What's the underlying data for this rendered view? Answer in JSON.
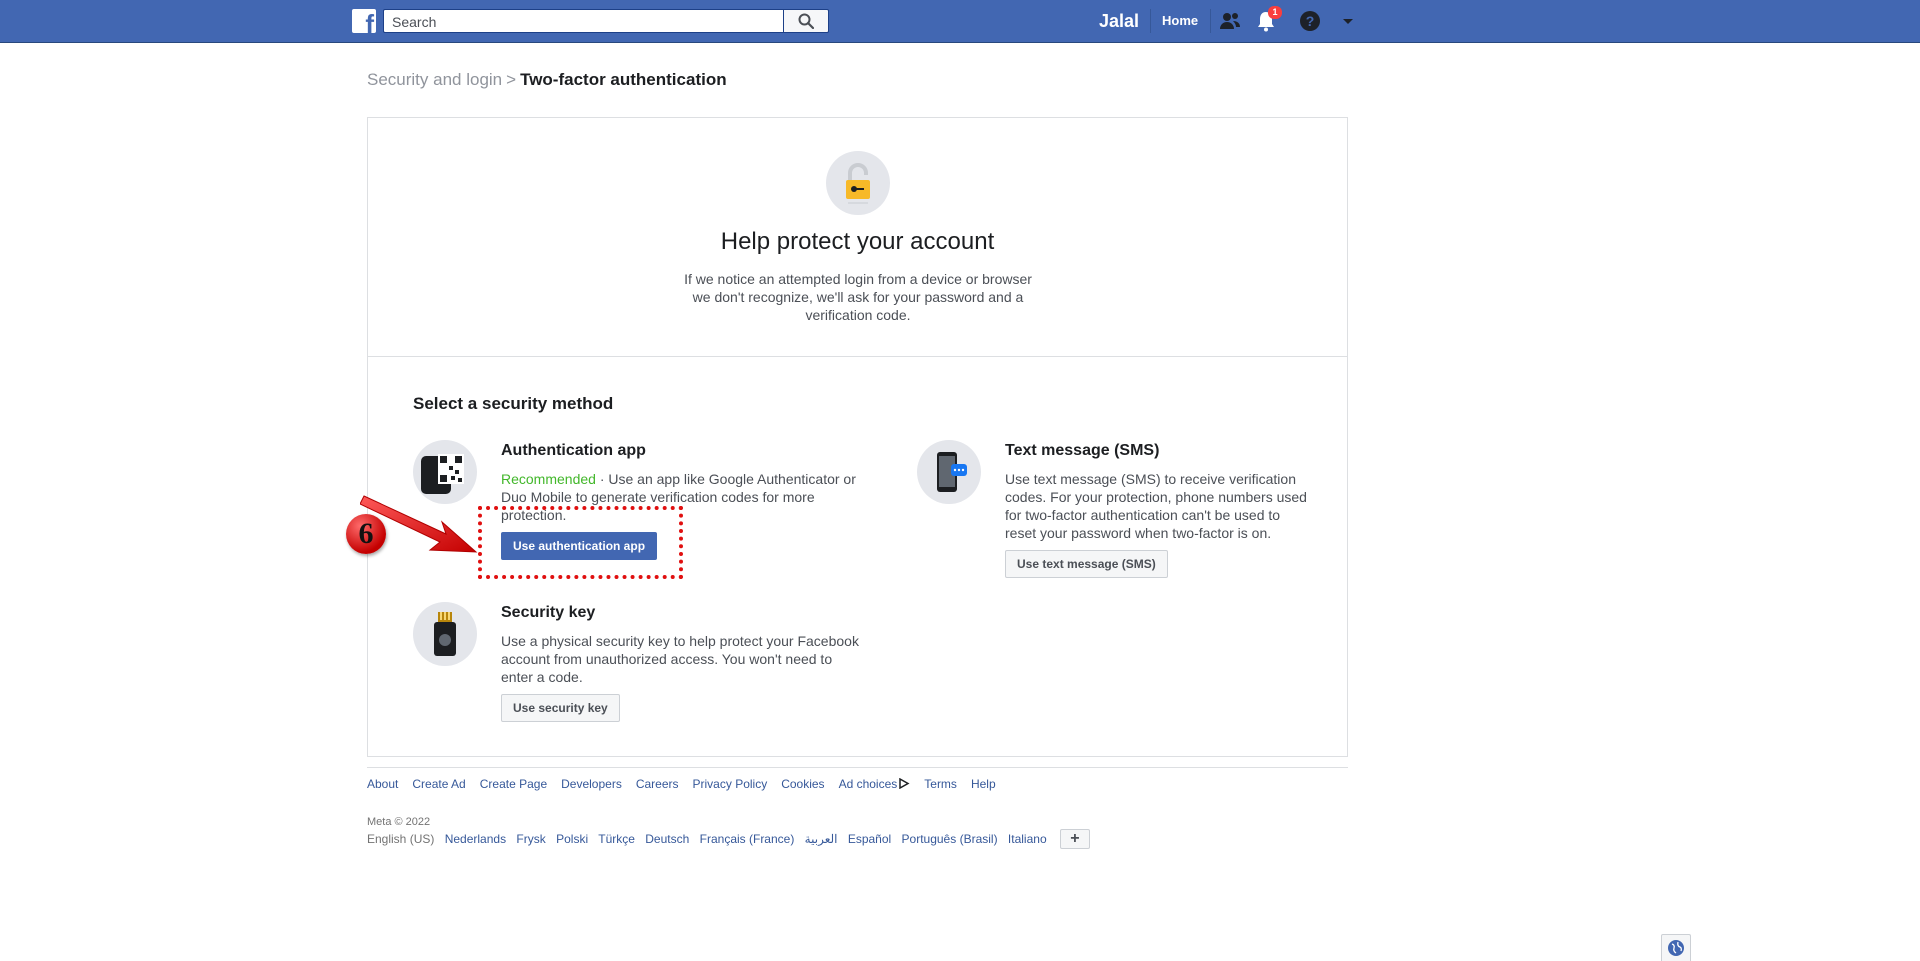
{
  "topbar": {
    "logo_letter": "f",
    "search_placeholder": "Search",
    "user_name": "Jalal",
    "home_label": "Home",
    "notifications_count": "1",
    "icons": [
      "search-icon",
      "friends-icon",
      "notifications-icon",
      "help-icon",
      "dropdown-arrow-icon"
    ]
  },
  "breadcrumb": {
    "parent": "Security and login",
    "separator": ">",
    "current": "Two-factor authentication"
  },
  "hero": {
    "icon": "lock-icon",
    "title": "Help protect your account",
    "description": "If we notice an attempted login from a device or browser we don't recognize, we'll ask for your password and a verification code."
  },
  "methods": {
    "section_title": "Select a security method",
    "auth_app": {
      "icon": "qr-phone-icon",
      "title": "Authentication app",
      "recommended": "Recommended",
      "description": " · Use an app like Google Authenticator or Duo Mobile to generate verification codes for more protection.",
      "button": "Use authentication app"
    },
    "sms": {
      "icon": "sms-phone-icon",
      "title": "Text message (SMS)",
      "description": "Use text message (SMS) to receive verification codes. For your protection, phone numbers used for two-factor authentication can't be used to reset your password when two-factor is on.",
      "button": "Use text message (SMS)"
    },
    "security_key": {
      "icon": "security-key-icon",
      "title": "Security key",
      "description": "Use a physical security key to help protect your Facebook account from unauthorized access. You won't need to enter a code.",
      "button": "Use security key"
    }
  },
  "annotation": {
    "step_number": "6",
    "color": "#e01010"
  },
  "footer": {
    "links": [
      "About",
      "Create Ad",
      "Create Page",
      "Developers",
      "Careers",
      "Privacy Policy",
      "Cookies",
      "Ad choices",
      "Terms",
      "Help"
    ],
    "copyright": "Meta © 2022",
    "current_language": "English (US)",
    "languages": [
      "Nederlands",
      "Frysk",
      "Polski",
      "Türkçe",
      "Deutsch",
      "Français (France)",
      "العربية",
      "Español",
      "Português (Brasil)",
      "Italiano"
    ],
    "add_language": "+"
  },
  "colors": {
    "brand_blue": "#4267b2",
    "recommended_green": "#42b72a",
    "link_blue": "#365899"
  }
}
